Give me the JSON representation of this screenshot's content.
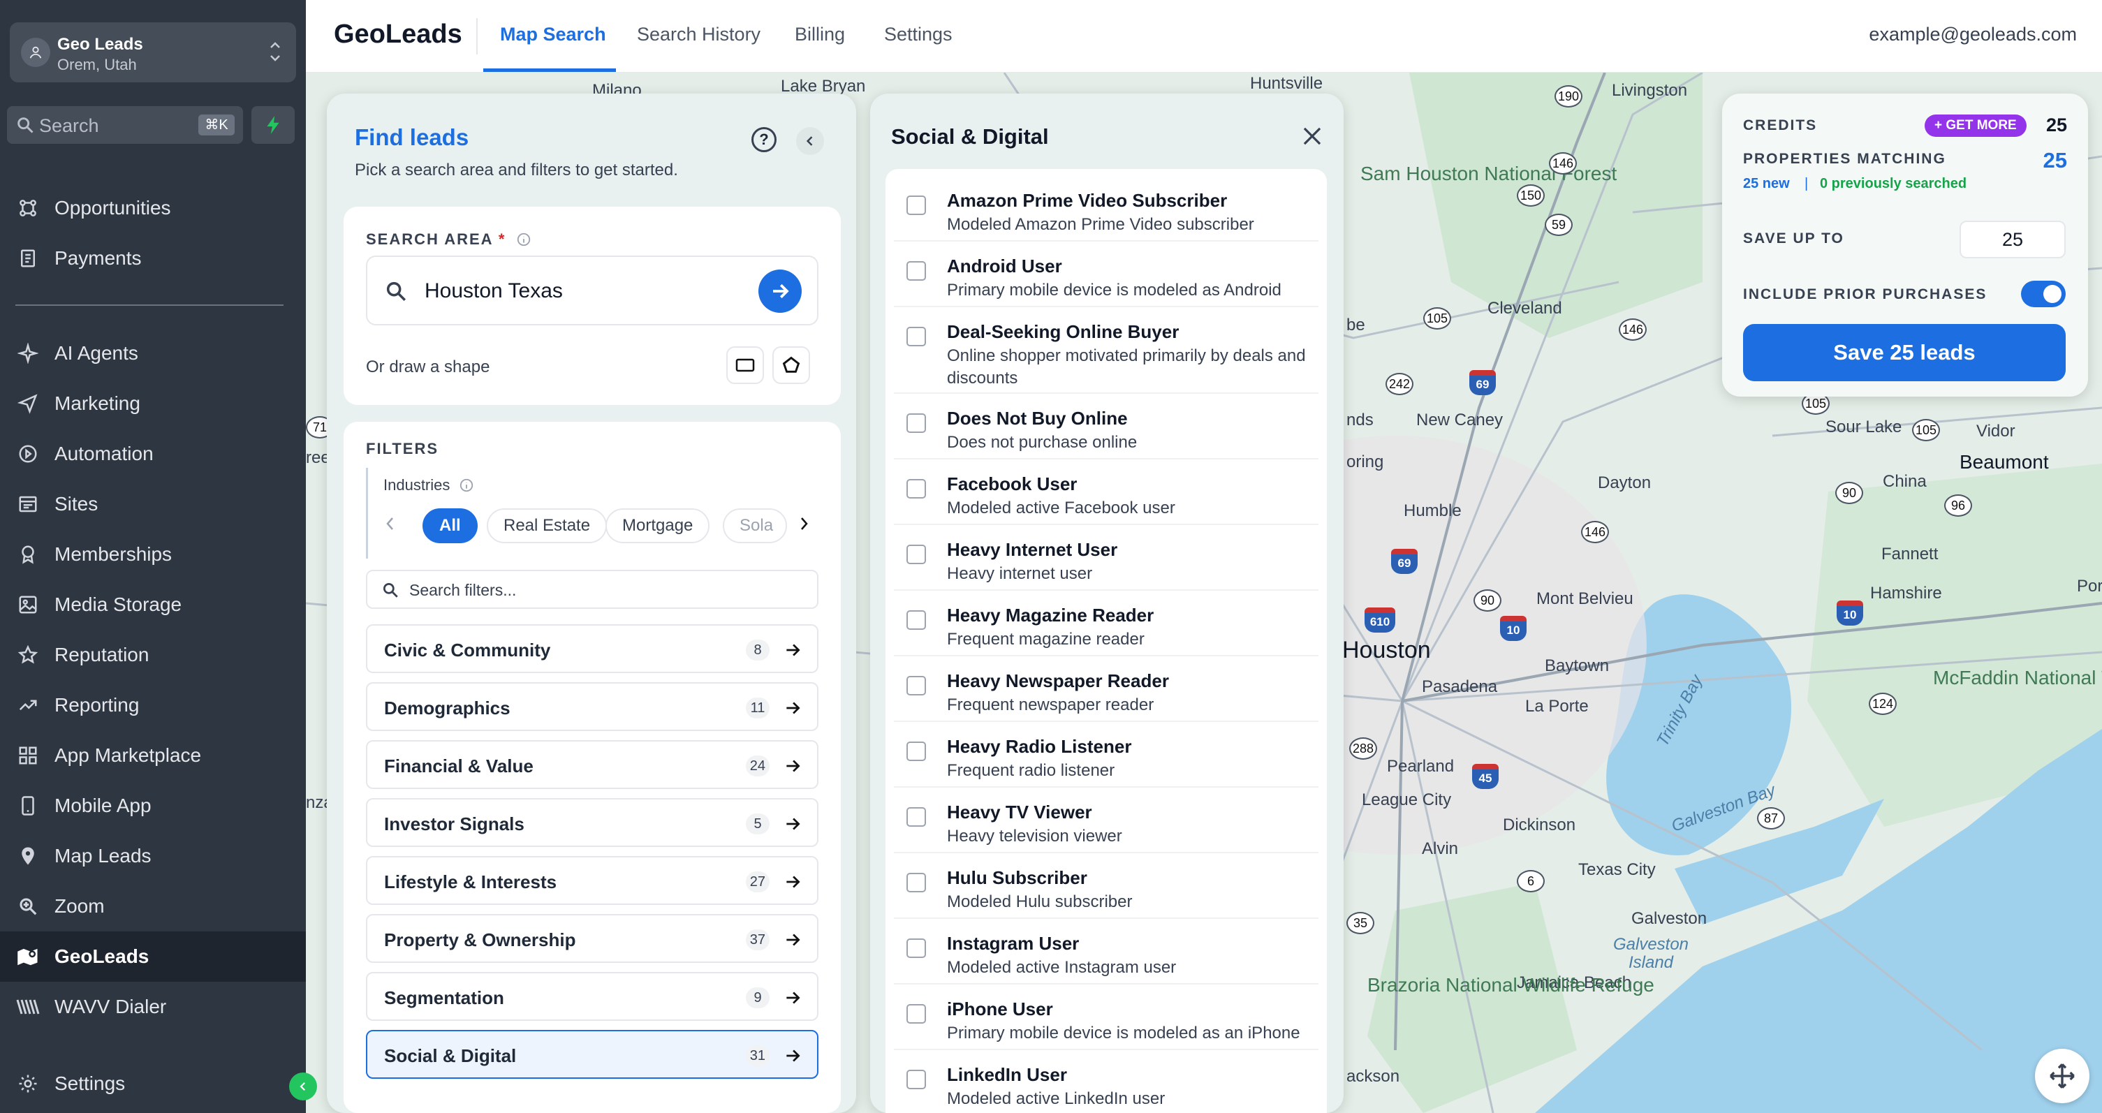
{
  "sidebar": {
    "location_name": "Geo Leads",
    "location_sub": "Orem, Utah",
    "search_label": "Search",
    "search_shortcut": "⌘K",
    "nav": [
      {
        "label": "Opportunities",
        "icon": "opportunities-icon"
      },
      {
        "label": "Payments",
        "icon": "payments-icon"
      },
      {
        "label": "AI Agents",
        "icon": "ai-agents-icon"
      },
      {
        "label": "Marketing",
        "icon": "send-icon"
      },
      {
        "label": "Automation",
        "icon": "automation-icon"
      },
      {
        "label": "Sites",
        "icon": "sites-icon"
      },
      {
        "label": "Memberships",
        "icon": "memberships-icon"
      },
      {
        "label": "Media Storage",
        "icon": "image-icon"
      },
      {
        "label": "Reputation",
        "icon": "star-icon"
      },
      {
        "label": "Reporting",
        "icon": "trend-icon"
      },
      {
        "label": "App Marketplace",
        "icon": "grid-icon"
      },
      {
        "label": "Mobile App",
        "icon": "phone-icon"
      },
      {
        "label": "Map Leads",
        "icon": "map-pin-icon"
      },
      {
        "label": "Zoom",
        "icon": "zoom-icon"
      },
      {
        "label": "GeoLeads",
        "icon": "map-icon"
      },
      {
        "label": "WAVV Dialer",
        "icon": "wavv-icon"
      },
      {
        "label": "Settings",
        "icon": "gear-icon"
      }
    ]
  },
  "header": {
    "brand": "GeoLeads",
    "tabs": [
      "Map Search",
      "Search History",
      "Billing",
      "Settings"
    ],
    "email": "example@geoleads.com"
  },
  "find_leads": {
    "title": "Find leads",
    "subtitle": "Pick a search area and filters to get started.",
    "search_area_label": "SEARCH AREA",
    "required_mark": "*",
    "search_area_value": "Houston Texas",
    "draw_shape_label": "Or draw a shape",
    "filters_label": "FILTERS",
    "industries_label": "Industries",
    "industries": [
      "All",
      "Real Estate",
      "Mortgage",
      "Sola"
    ],
    "search_filters_placeholder": "Search filters...",
    "categories": [
      {
        "name": "Civic & Community",
        "count": "8"
      },
      {
        "name": "Demographics",
        "count": "11"
      },
      {
        "name": "Financial & Value",
        "count": "24"
      },
      {
        "name": "Investor Signals",
        "count": "5"
      },
      {
        "name": "Lifestyle & Interests",
        "count": "27"
      },
      {
        "name": "Property & Ownership",
        "count": "37"
      },
      {
        "name": "Segmentation",
        "count": "9"
      },
      {
        "name": "Social & Digital",
        "count": "31"
      }
    ]
  },
  "social_digital": {
    "title": "Social & Digital",
    "options": [
      {
        "title": "Amazon Prime Video Subscriber",
        "desc": "Modeled Amazon Prime Video subscriber"
      },
      {
        "title": "Android User",
        "desc": "Primary mobile device is modeled as Android"
      },
      {
        "title": "Deal-Seeking Online Buyer",
        "desc": "Online shopper motivated primarily by deals and discounts"
      },
      {
        "title": "Does Not Buy Online",
        "desc": "Does not purchase online"
      },
      {
        "title": "Facebook User",
        "desc": "Modeled active Facebook user"
      },
      {
        "title": "Heavy Internet User",
        "desc": "Heavy internet user"
      },
      {
        "title": "Heavy Magazine Reader",
        "desc": "Frequent magazine reader"
      },
      {
        "title": "Heavy Newspaper Reader",
        "desc": "Frequent newspaper reader"
      },
      {
        "title": "Heavy Radio Listener",
        "desc": "Frequent radio listener"
      },
      {
        "title": "Heavy TV Viewer",
        "desc": "Heavy television viewer"
      },
      {
        "title": "Hulu Subscriber",
        "desc": "Modeled Hulu subscriber"
      },
      {
        "title": "Instagram User",
        "desc": "Modeled active Instagram user"
      },
      {
        "title": "iPhone User",
        "desc": "Primary mobile device is modeled as an iPhone"
      },
      {
        "title": "LinkedIn User",
        "desc": "Modeled active LinkedIn user"
      }
    ]
  },
  "credits": {
    "credits_label": "CREDITS",
    "get_more": "+ GET MORE",
    "credits_value": "25",
    "matching_label": "PROPERTIES MATCHING",
    "matching_value": "25",
    "new_text": "25 new",
    "separator": "|",
    "prev_text": "0 previously searched",
    "save_up_label": "SAVE UP TO",
    "save_up_value": "25",
    "include_label": "INCLUDE PRIOR PURCHASES",
    "include_on": true,
    "save_button": "Save 25 leads"
  },
  "map": {
    "place_labels": [
      "Milano",
      "Lake Bryan",
      "Huntsville",
      "Livingston",
      "Sam Houston National Forest",
      "Cleveland",
      "New Caney",
      "Humble",
      "Dayton",
      "Sour Lake",
      "Vidor",
      "Beaumont",
      "China",
      "Fannett",
      "Hamshire",
      "Port",
      "Mont Belvieu",
      "Houston",
      "Baytown",
      "Pasadena",
      "La Porte",
      "McFaddin National Wildlife Refuge",
      "Pearland",
      "League City",
      "Dickinson",
      "Alvin",
      "Texas City",
      "Galveston",
      "Galveston Island",
      "Jamaica Beach",
      "Brazoria National Wildlife Refuge",
      "Trinity Bay",
      "Galveston Bay",
      "nds",
      "oring",
      "be",
      "ree",
      "nza",
      "ackson"
    ],
    "route_shields": [
      "190",
      "146",
      "150",
      "59",
      "105",
      "146",
      "242",
      "69",
      "105",
      "105",
      "90",
      "96",
      "146",
      "69",
      "90",
      "610",
      "10",
      "10",
      "124",
      "288",
      "45",
      "87",
      "6",
      "35",
      "71"
    ]
  }
}
